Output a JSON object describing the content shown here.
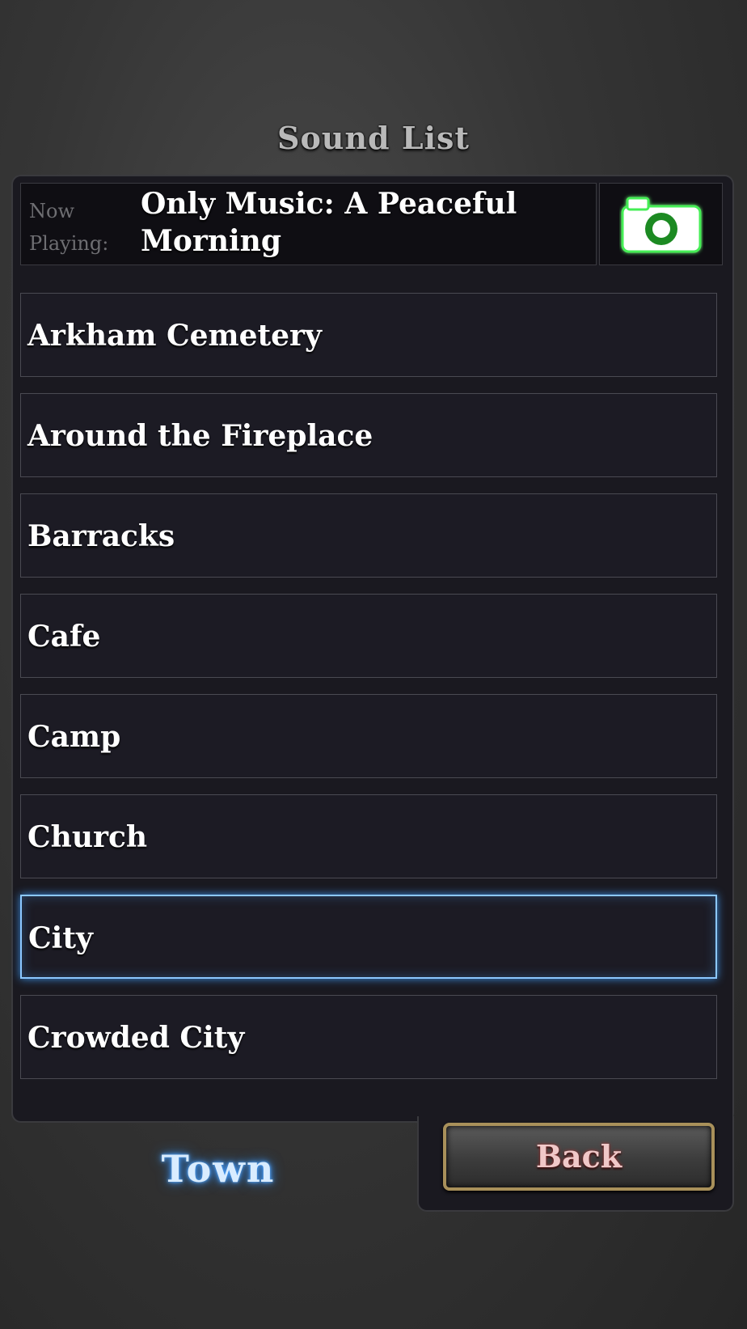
{
  "header": {
    "title": "Sound List"
  },
  "now_playing": {
    "label": "Now Playing:",
    "track": "Only Music: A Peaceful Morning"
  },
  "camera_button": {
    "icon": "camera-icon",
    "color": "#22cc33"
  },
  "sounds": [
    {
      "label": "Arkham Cemetery",
      "selected": false
    },
    {
      "label": "Around the Fireplace",
      "selected": false
    },
    {
      "label": "Barracks",
      "selected": false
    },
    {
      "label": "Cafe",
      "selected": false
    },
    {
      "label": "Camp",
      "selected": false
    },
    {
      "label": "Church",
      "selected": false
    },
    {
      "label": "City",
      "selected": true
    },
    {
      "label": "Crowded City",
      "selected": false
    }
  ],
  "footer": {
    "category": "Town",
    "back_label": "Back"
  },
  "colors": {
    "selection_glow": "#8cc8ff",
    "back_border": "#a8905a"
  }
}
